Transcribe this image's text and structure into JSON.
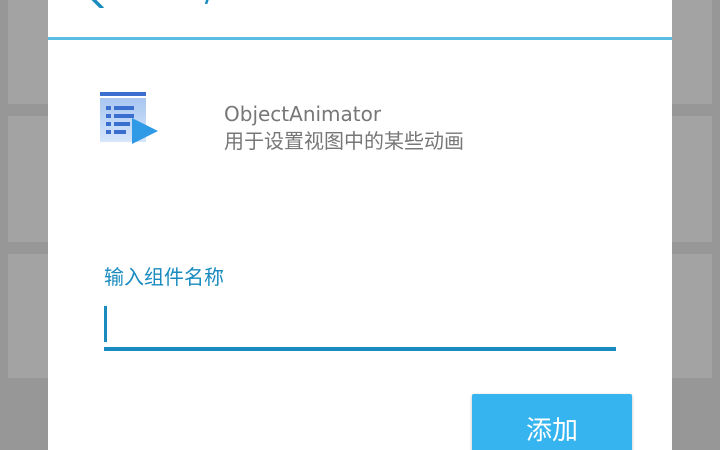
{
  "component": {
    "name": "ObjectAnimator",
    "description": "用于设置视图中的某些动画",
    "icon": "animation-list-play-icon"
  },
  "form": {
    "label": "输入组件名称",
    "value": "",
    "placeholder": ""
  },
  "actions": {
    "add_label": "添加"
  },
  "header": {
    "back_icon": "back-arrow-icon"
  },
  "colors": {
    "accent": "#1a8bbf",
    "header_divider": "#5bbde4",
    "button": "#35b4ef",
    "secondary_text": "#777777"
  }
}
